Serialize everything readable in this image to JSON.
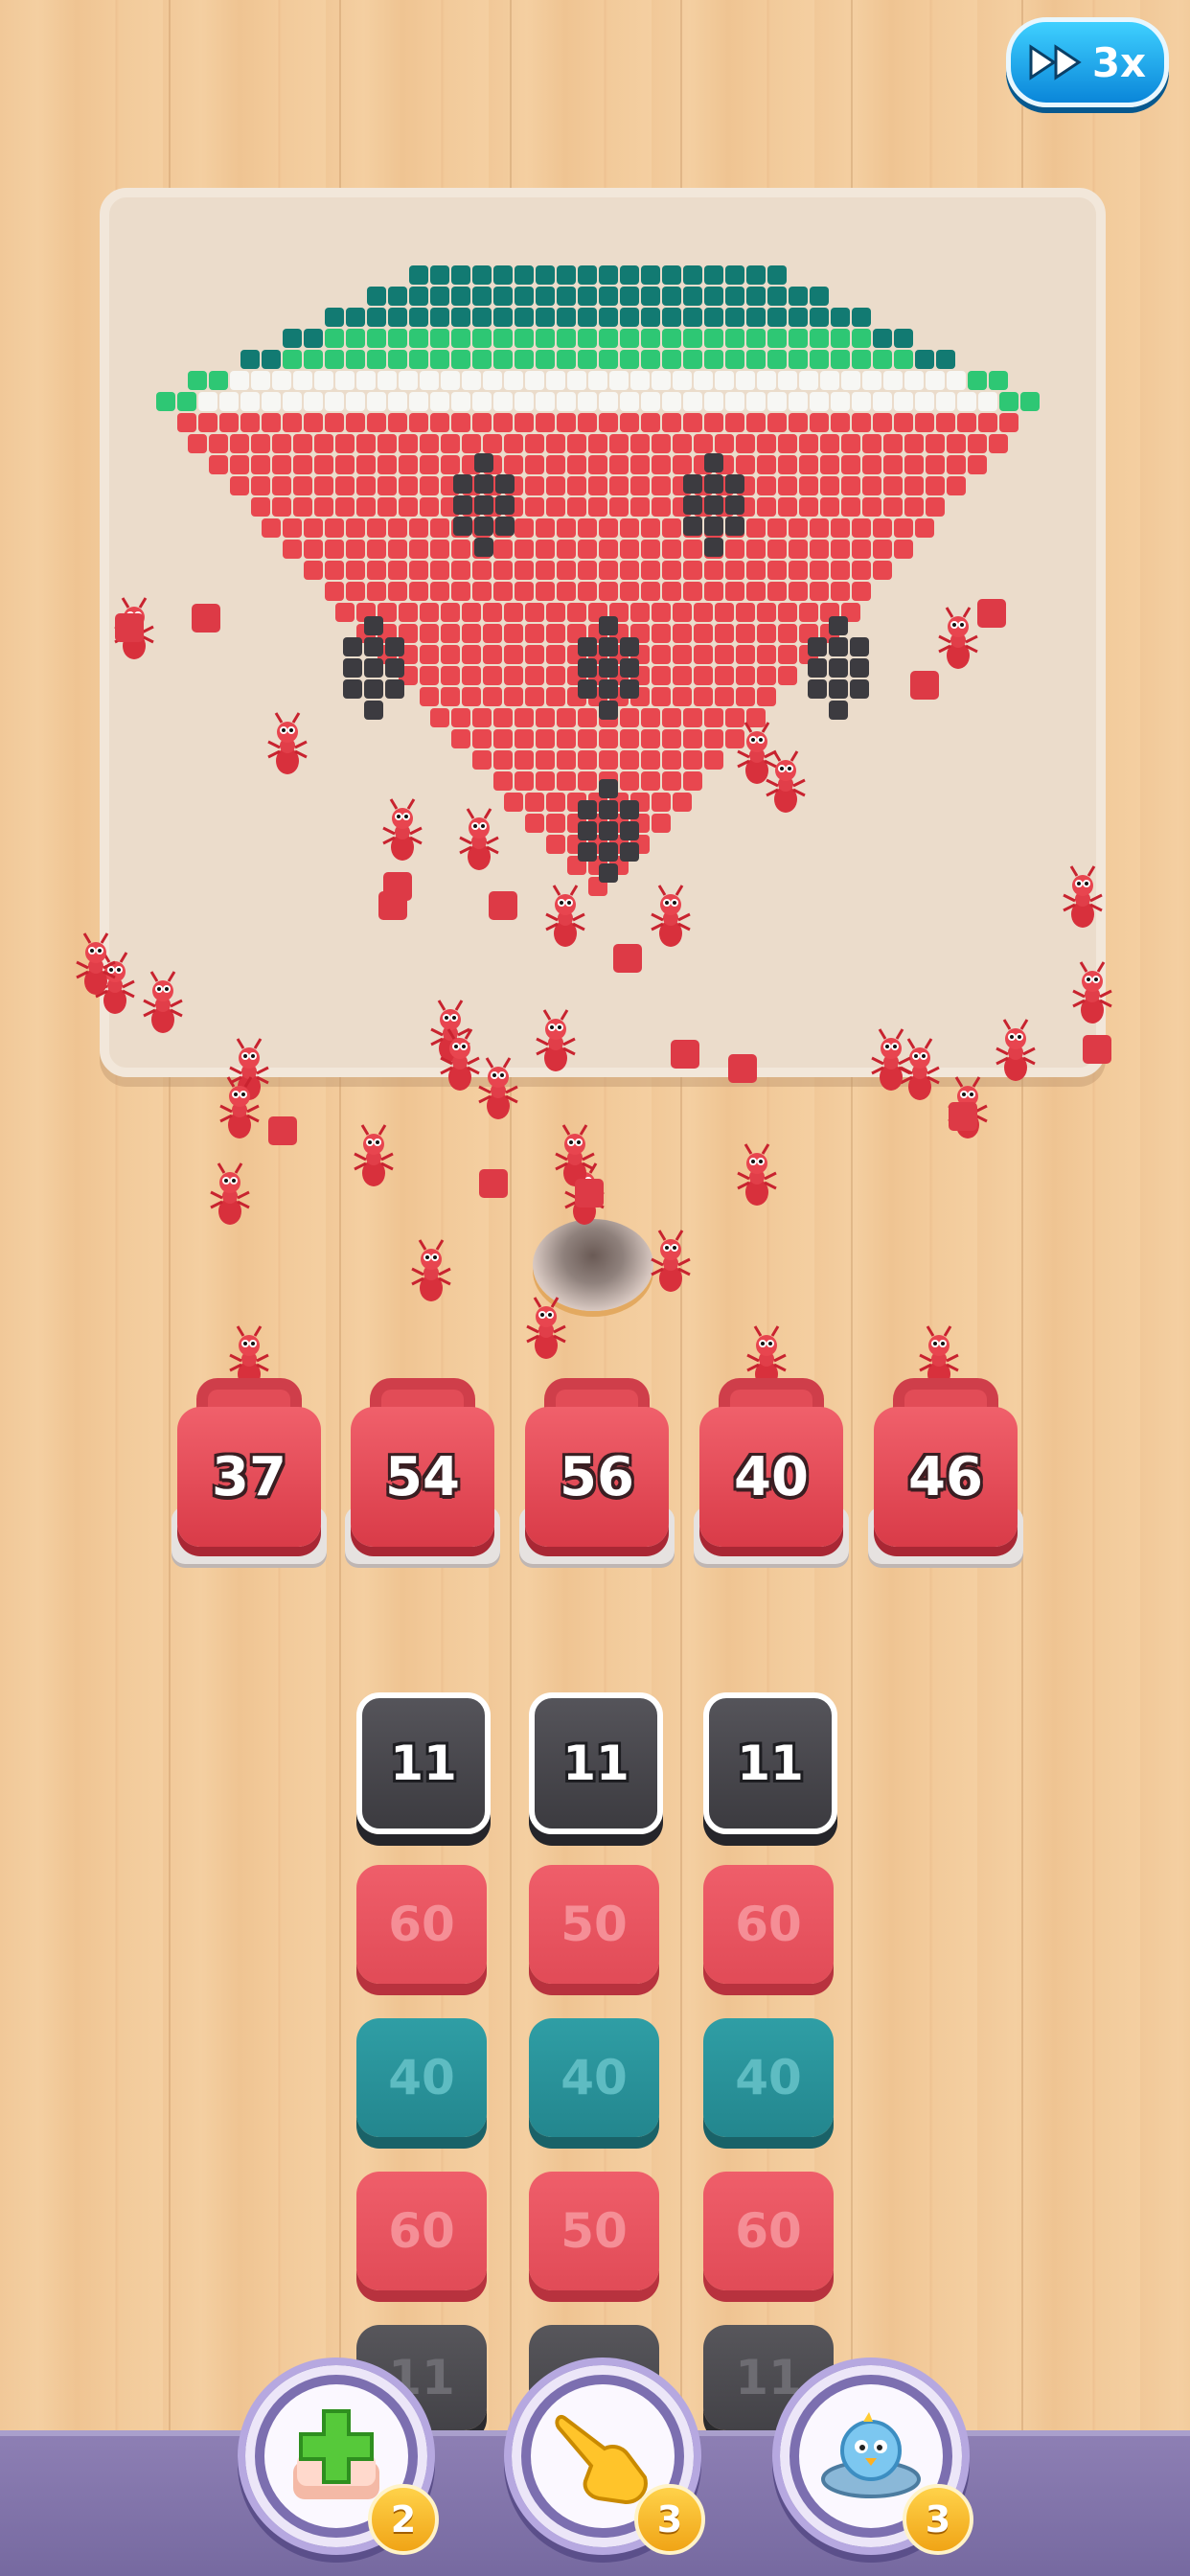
{
  "speed_button": {
    "label": "3x",
    "icon": "fast-forward-icon"
  },
  "puzzle": {
    "picture": "watermelon-slice-pixel-art"
  },
  "containers": [
    {
      "value": "37"
    },
    {
      "value": "54"
    },
    {
      "value": "56"
    },
    {
      "value": "40"
    },
    {
      "value": "46"
    }
  ],
  "tile_grid": [
    [
      {
        "value": "11",
        "color": "dark"
      },
      {
        "value": "11",
        "color": "dark"
      },
      {
        "value": "11",
        "color": "dark"
      }
    ],
    [
      {
        "value": "60",
        "color": "red"
      },
      {
        "value": "50",
        "color": "red"
      },
      {
        "value": "60",
        "color": "red"
      }
    ],
    [
      {
        "value": "40",
        "color": "teal"
      },
      {
        "value": "40",
        "color": "teal"
      },
      {
        "value": "40",
        "color": "teal"
      }
    ],
    [
      {
        "value": "60",
        "color": "red"
      },
      {
        "value": "50",
        "color": "red"
      },
      {
        "value": "60",
        "color": "red"
      }
    ],
    [
      {
        "value": "11",
        "color": "darkfaded"
      },
      {
        "value": "",
        "color": "darkfaded"
      },
      {
        "value": "11",
        "color": "darkfaded"
      }
    ]
  ],
  "boosters": [
    {
      "icon": "add-slot-icon",
      "count": "2"
    },
    {
      "icon": "pointing-hand-icon",
      "count": "3"
    },
    {
      "icon": "ufo-bird-icon",
      "count": "3"
    }
  ],
  "colors": {
    "watermelon_red": "#e8474f",
    "rind_dark": "#127a72",
    "rind_green": "#2ec774",
    "seed": "#3c3b40",
    "container_red": "#e24c57",
    "tile_teal": "#2a939a"
  }
}
